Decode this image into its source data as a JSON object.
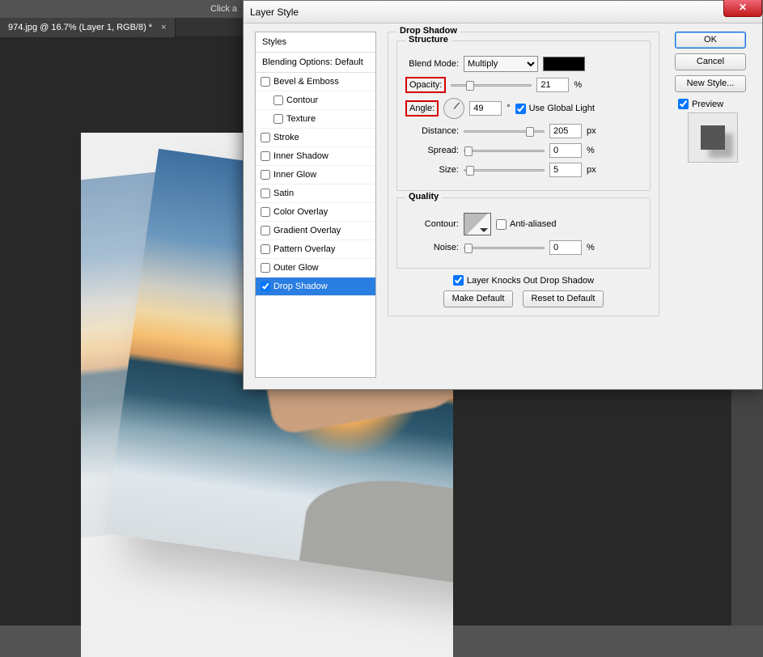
{
  "app": {
    "title_fragment": "Click a"
  },
  "document_tab": {
    "label": "974.jpg @ 16.7% (Layer 1, RGB/8) *",
    "close_glyph": "×"
  },
  "dialog": {
    "title": "Layer Style",
    "close_glyph": "✕",
    "styles_header": "Styles",
    "blending_options": "Blending Options: Default",
    "styles": [
      {
        "label": "Bevel & Emboss",
        "checked": false
      },
      {
        "label": "Contour",
        "checked": false,
        "sub": true
      },
      {
        "label": "Texture",
        "checked": false,
        "sub": true
      },
      {
        "label": "Stroke",
        "checked": false
      },
      {
        "label": "Inner Shadow",
        "checked": false
      },
      {
        "label": "Inner Glow",
        "checked": false
      },
      {
        "label": "Satin",
        "checked": false
      },
      {
        "label": "Color Overlay",
        "checked": false
      },
      {
        "label": "Gradient Overlay",
        "checked": false
      },
      {
        "label": "Pattern Overlay",
        "checked": false
      },
      {
        "label": "Outer Glow",
        "checked": false
      },
      {
        "label": "Drop Shadow",
        "checked": true,
        "selected": true
      }
    ],
    "section": {
      "title": "Drop Shadow",
      "structure": {
        "legend": "Structure",
        "blend_mode_label": "Blend Mode:",
        "blend_mode_value": "Multiply",
        "color": "#000000",
        "opacity_label": "Opacity:",
        "opacity_value": "21",
        "opacity_unit": "%",
        "angle_label": "Angle:",
        "angle_value": "49",
        "angle_unit": "°",
        "use_global_light_label": "Use Global Light",
        "use_global_light_checked": true,
        "distance_label": "Distance:",
        "distance_value": "205",
        "distance_unit": "px",
        "spread_label": "Spread:",
        "spread_value": "0",
        "spread_unit": "%",
        "size_label": "Size:",
        "size_value": "5",
        "size_unit": "px"
      },
      "quality": {
        "legend": "Quality",
        "contour_label": "Contour:",
        "anti_aliased_label": "Anti-aliased",
        "anti_aliased_checked": false,
        "noise_label": "Noise:",
        "noise_value": "0",
        "noise_unit": "%"
      },
      "knockout_label": "Layer Knocks Out Drop Shadow",
      "knockout_checked": true,
      "make_default": "Make Default",
      "reset_default": "Reset to Default"
    },
    "buttons": {
      "ok": "OK",
      "cancel": "Cancel",
      "new_style": "New Style...",
      "preview_label": "Preview",
      "preview_checked": true
    }
  }
}
